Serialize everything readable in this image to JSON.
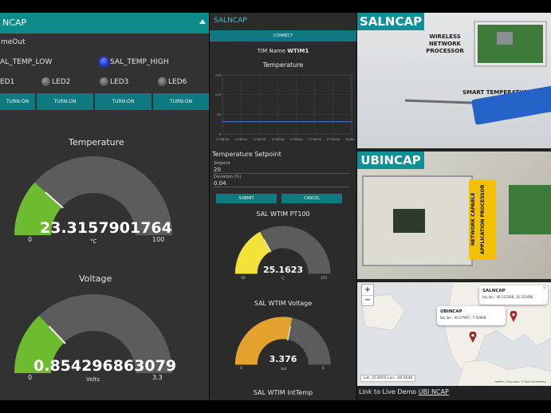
{
  "left": {
    "header": "NCAP",
    "timeout_label": "meOut",
    "temp_low_label": "AL_TEMP_LOW",
    "temp_high_label": "SAL_TEMP_HIGH",
    "leds": [
      "ED1",
      "LED2",
      "LED3",
      "LED6"
    ],
    "turn_on_labels": [
      "TURN:ON",
      "TURN:ON",
      "TURN:ON",
      "TURN:ON"
    ],
    "gauge_temp": {
      "title": "Temperature",
      "value": "23.3157901764",
      "unit": "°C",
      "min": "0",
      "max": "100",
      "fraction": 0.233
    },
    "gauge_volt": {
      "title": "Voltage",
      "value": "0.854296863079",
      "unit": "Volts",
      "min": "0",
      "max": "3.3",
      "fraction": 0.259
    }
  },
  "mid": {
    "header": "SALNCAP",
    "connect_label": "CONNECT",
    "tim_name_label": "TIM Name",
    "tim_name_value": "WTIM1",
    "chart_title": "Temperature",
    "setpoint_title": "Temperature Setpoint",
    "setpoint_label": "Setpoint",
    "setpoint_value": "20",
    "deviation_label": "Deviation (%)",
    "deviation_value": "0.04",
    "submit_label": "SUBMIT",
    "cancel_label": "CANCEL",
    "gauge_pt100": {
      "title": "SAL WTIM PT100",
      "value": "25.1623",
      "unit": "°C",
      "min": "-50",
      "max": "170",
      "fraction": 0.341,
      "color": "#f2e23a"
    },
    "gauge_voltage": {
      "title": "SAL WTIM Voltage",
      "value": "3.376",
      "unit": "Volt",
      "min": "0",
      "max": "6",
      "fraction": 0.563,
      "color": "#e3a12e"
    },
    "bottom_title": "SAL WTIM IntTemp"
  },
  "chart_data": {
    "type": "line",
    "title": "Temperature",
    "xlabel": "",
    "ylabel": "",
    "x": [
      "17:58:00",
      "17:58:10",
      "17:58:20",
      "17:58:30",
      "17:58:40",
      "17:58:50",
      "17:59:00",
      "18:00:00"
    ],
    "ylim": [
      0,
      120
    ],
    "yticks": [
      "120",
      "115",
      "55",
      "0"
    ],
    "series": [
      {
        "values": [
          25,
          25,
          25,
          25,
          25,
          25,
          25,
          25
        ]
      }
    ],
    "color": "#3c7dd9"
  },
  "right": {
    "salncap_title": "SALNCAP",
    "wireless_label": "WIRELESS\nNETWORK\nPROCESSOR",
    "smart_temp_label": "SMART TEMPERATURE SENS",
    "ubincap_title": "UBINCAP",
    "ncap_label": "NETWORK CAPABLE\nAPPLICATION PROCESSOR",
    "map": {
      "zoom_in": "+",
      "zoom_out": "−",
      "popup_sal_title": "SALNCAP",
      "popup_sal_coords": "lat, lon : 40.337306, 14.315496",
      "popup_ubi_title": "UBINCAP",
      "popup_ubi_coords": "lat, lon : 40.27997, -7.50908",
      "close": "×",
      "cursor_coords": "Lat: 25.8055  Lon: -40.4046",
      "attribution": "Leaflet | Map data © OpenStreetMap"
    },
    "link_text": "Link to Live Demo",
    "link_anchor": "UBI NCAP"
  }
}
